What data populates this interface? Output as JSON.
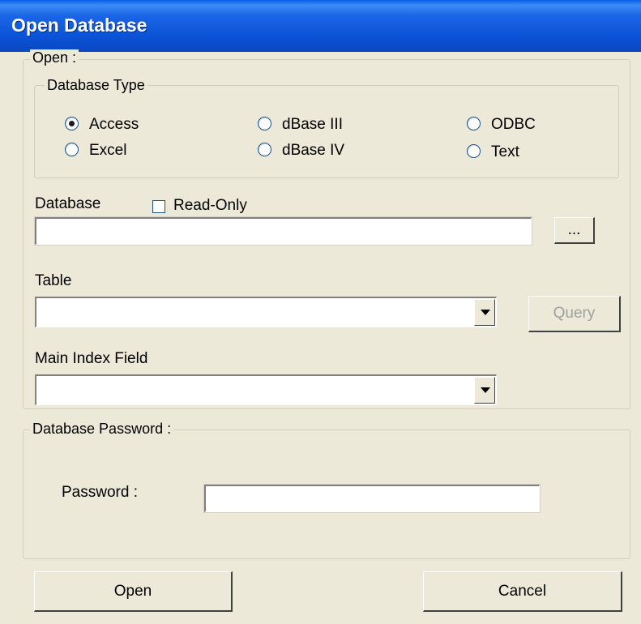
{
  "window": {
    "title": "Open Database"
  },
  "open_group": {
    "legend": "Open :",
    "db_type": {
      "legend": "Database Type",
      "options": [
        {
          "label": "Access",
          "checked": true
        },
        {
          "label": "Excel",
          "checked": false
        },
        {
          "label": "dBase III",
          "checked": false
        },
        {
          "label": "dBase IV",
          "checked": false
        },
        {
          "label": "ODBC",
          "checked": false
        },
        {
          "label": "Text",
          "checked": false
        }
      ]
    },
    "database_label": "Database",
    "read_only_label": "Read-Only",
    "read_only_checked": false,
    "database_value": "",
    "browse_label": "...",
    "table_label": "Table",
    "table_value": "",
    "query_label": "Query",
    "main_index_label": "Main Index Field",
    "main_index_value": ""
  },
  "password_group": {
    "legend": "Database Password :",
    "password_label": "Password :",
    "password_value": ""
  },
  "buttons": {
    "open": "Open",
    "cancel": "Cancel"
  }
}
